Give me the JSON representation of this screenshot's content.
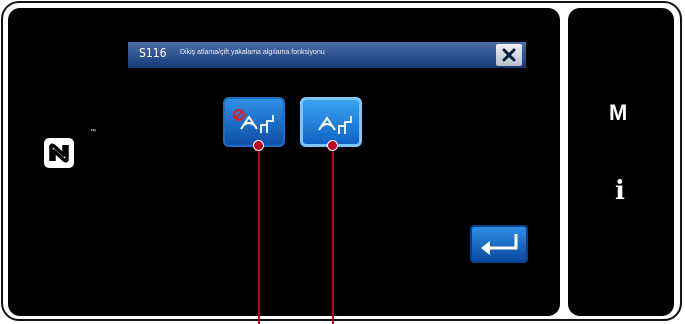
{
  "dialog": {
    "code": "S116",
    "title": "Dikiş atlama/çift yakalama algılama fonksiyonu"
  },
  "side": {
    "menu_label": "M",
    "info_label": "i",
    "trademark": "™"
  },
  "colors": {
    "accent": "#1a6fc6",
    "callout": "#c00020"
  },
  "icons": {
    "close": "close-icon",
    "detection_off": "detection-disabled-icon",
    "detection_on": "detection-enabled-icon",
    "enter": "enter-icon",
    "nfc": "nfc-icon"
  }
}
